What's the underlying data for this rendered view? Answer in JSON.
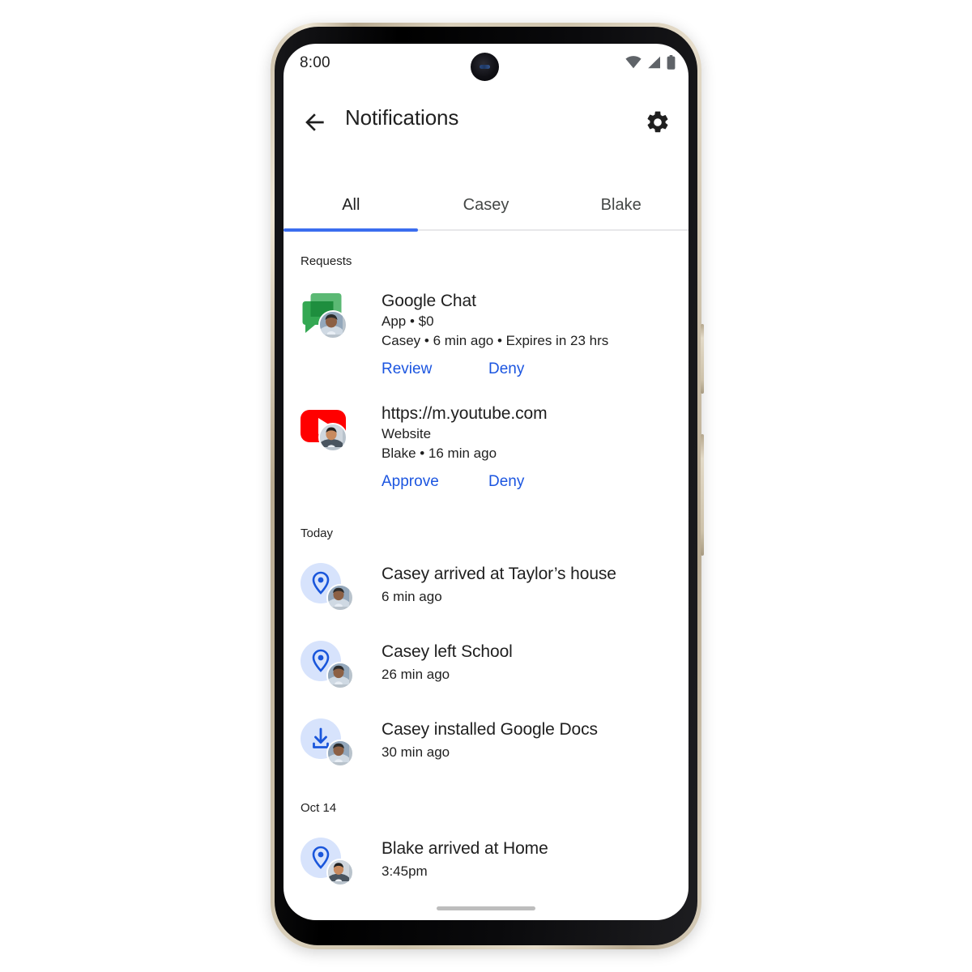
{
  "device": {
    "frame_color": "#d4c9b2",
    "screen_bg": "#ffffff"
  },
  "status_bar": {
    "time": "8:00",
    "icons": [
      "wifi-icon",
      "cellular-signal-icon",
      "battery-icon"
    ]
  },
  "app_bar": {
    "back_icon": "back-arrow-icon",
    "title": "Notifications",
    "settings_icon": "gear-icon"
  },
  "tabs": {
    "active_index": 0,
    "active_color": "#3b6def",
    "items": [
      {
        "label": "All"
      },
      {
        "label": "Casey"
      },
      {
        "label": "Blake"
      }
    ]
  },
  "sections": [
    {
      "label": "Requests",
      "requests": [
        {
          "icon": "google-chat-icon",
          "avatar": "casey-avatar",
          "title": "Google Chat",
          "subtitle": "App • $0",
          "meta": "Casey • 6 min ago • Expires in 23 hrs",
          "actions": [
            {
              "label": "Review"
            },
            {
              "label": "Deny"
            }
          ]
        },
        {
          "icon": "youtube-icon",
          "avatar": "blake-avatar",
          "title": "https://m.youtube.com",
          "subtitle": "Website",
          "meta": "Blake • 16 min ago",
          "actions": [
            {
              "label": "Approve"
            },
            {
              "label": "Deny"
            }
          ]
        }
      ]
    },
    {
      "label": "Today",
      "events": [
        {
          "icon": "location-pin-icon",
          "avatar": "casey-avatar",
          "title": "Casey arrived at Taylor’s house",
          "time": "6 min ago"
        },
        {
          "icon": "location-pin-icon",
          "avatar": "casey-avatar",
          "title": "Casey left School",
          "time": "26 min ago"
        },
        {
          "icon": "download-icon",
          "avatar": "casey-avatar",
          "title": "Casey installed Google Docs",
          "time": "30 min ago"
        }
      ]
    },
    {
      "label": "Oct 14",
      "events": [
        {
          "icon": "location-pin-icon",
          "avatar": "blake-avatar",
          "title": "Blake arrived at Home",
          "time": "3:45pm"
        }
      ]
    }
  ],
  "colors": {
    "link_blue": "#1b55e0",
    "icon_circle_blue": "#d7e3fc",
    "pin_blue": "#1a56db",
    "chat_green": "#34a853",
    "youtube_red": "#ff0000",
    "text_primary": "#1f1f1f",
    "text_secondary": "#444746"
  }
}
